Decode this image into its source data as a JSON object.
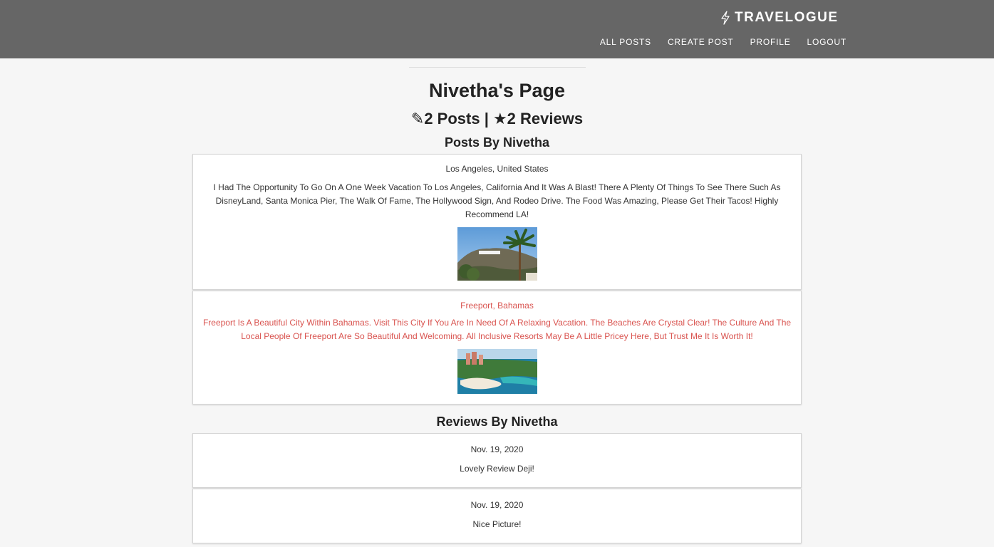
{
  "header": {
    "brand": "TRAVELOGUE",
    "brand_icon": "lightning-bolt-icon",
    "nav": [
      "ALL POSTS",
      "CREATE POST",
      "PROFILE",
      "LOGOUT"
    ]
  },
  "profile": {
    "title": "Nivetha's Page",
    "stats": "✎2 Posts | ★2 Reviews"
  },
  "posts": {
    "heading": "Posts By Nivetha",
    "items": [
      {
        "location": "Los Angeles, United States",
        "text": "I Had The Opportunity To Go On A One Week Vacation To Los Angeles, California And It Was A Blast! There A Plenty Of Things To See There Such As DisneyLand, Santa Monica Pier, The Walk Of Fame, The Hollywood Sign, And Rodeo Drive. The Food Was Amazing, Please Get Their Tacos! Highly Recommend LA!",
        "image": "hollywood-sign-photo"
      },
      {
        "location": "Freeport, Bahamas",
        "text": "Freeport Is A Beautiful City Within Bahamas. Visit This City If You Are In Need Of A Relaxing Vacation. The Beaches Are Crystal Clear! The Culture And The Local People Of Freeport Are So Beautiful And Welcoming. All Inclusive Resorts May Be A Little Pricey Here, But Trust Me It Is Worth It!",
        "image": "bahamas-resort-photo",
        "text_color": "#d9534f"
      }
    ]
  },
  "reviews": {
    "heading": "Reviews By Nivetha",
    "items": [
      {
        "date": "Nov. 19, 2020",
        "text": "Lovely Review Deji!"
      },
      {
        "date": "Nov. 19, 2020",
        "text": "Nice Picture!"
      }
    ]
  },
  "colors": {
    "header_bg": "#666666",
    "page_bg": "#f6f6f6",
    "accent_red": "#d9534f"
  }
}
